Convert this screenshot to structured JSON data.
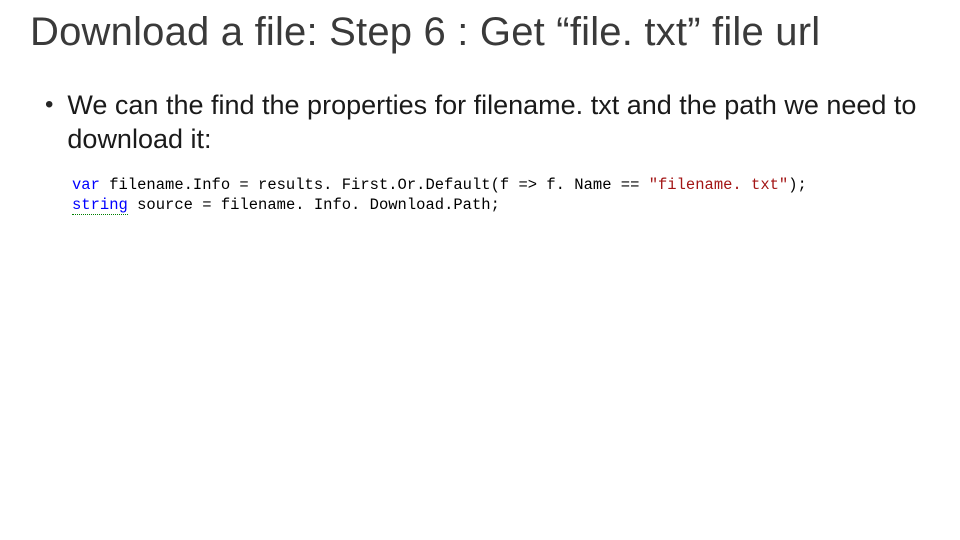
{
  "slide": {
    "title": "Download a file: Step 6 : Get “file. txt” file url",
    "bullet": "We can the find the properties for filename. txt and the path we need to download it:"
  },
  "code": {
    "kw_var": "var",
    "line1_mid": " filename.Info = results. First.Or.Default(f => f. Name == ",
    "str1": "\"filename. txt\"",
    "line1_end": ");",
    "kw_string": "string",
    "line2_rest": " source = filename. Info. Download.Path;"
  }
}
